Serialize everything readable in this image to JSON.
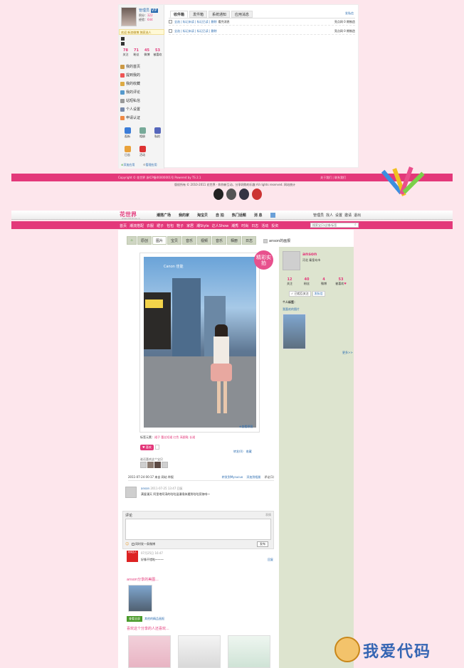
{
  "top": {
    "user_name": "管理员",
    "user_badge": "VIP",
    "points_label": "积分：",
    "points": "322",
    "exp_label": "经验：",
    "exp": "644",
    "msg": "欢迎 新浪微博 独家选人",
    "stats": [
      {
        "n": "78",
        "l": "关注"
      },
      {
        "n": "71",
        "l": "粉丝"
      },
      {
        "n": "45",
        "l": "微博"
      },
      {
        "n": "53",
        "l": "被喜欢"
      }
    ],
    "menu": [
      "我的首页",
      "提到我的",
      "我的收藏",
      "我的评论",
      "站短私信",
      "个人设置",
      "申请认证"
    ],
    "apps": [
      "逛街",
      "相册",
      "私拍",
      "日志",
      "活动"
    ],
    "add_app": "添加应用",
    "manage_app": "管理应用",
    "tabs": [
      "收件箱",
      "发件箱",
      "系统通知",
      "应用消息"
    ],
    "tab_more": "发私信",
    "rows": [
      {
        "ops": "全选 | 标记未读 | 标记已读 | 删除",
        "msg": "看完消息",
        "who": "亮点网 0 期制造"
      },
      {
        "ops": "全选 | 标记未读 | 标记已读 | 删除",
        "msg": "",
        "who": "亮点网 0 期制造"
      }
    ],
    "foot_left": "Copyright © 花世界  浙ICP备06000001号 Powered by TS 2.1",
    "foot_right": "关于我们 | 联系我们",
    "copyright2": "版权所有 © 2010-2011 花世界 - 和你新互动，分享网购的乐趣 All rights reserved. 网站统计"
  },
  "site": {
    "logo": "花世界",
    "logo_sub": "www.2010hua.cn",
    "nav": [
      "潮搭广场",
      "我的家",
      "淘宝贝",
      "自 拍",
      "热门话题",
      "消 息"
    ],
    "nav_right": [
      "管理员",
      "找人",
      "设置",
      "邀请",
      "退出"
    ],
    "cats": [
      "首页",
      "潮流搭配",
      "衣服",
      "裙子",
      "包包",
      "鞋子",
      "家居",
      "潮Style",
      "达人Show",
      "潮秀",
      "时尚",
      "日志",
      "活动",
      "投资"
    ],
    "search_placeholder": "搜索宝贝/店铺/标签"
  },
  "photo_tabs": [
    "",
    "原创",
    "图片",
    "宝贝",
    "音乐",
    "视频",
    "音乐",
    "相册",
    "日志"
  ],
  "owner_tab": "anson的画报",
  "post": {
    "badge": "精彩实拍",
    "img_caption": "Canon 佳能",
    "view_large": "查看原图",
    "tags_label": "标签元素：",
    "tags": "裙子 蕾丝短裙 红色 高跟鞋 长裙",
    "like_label": "喜欢",
    "share": "转发(0)",
    "collect": "收藏",
    "likers_label": "谁还喜欢这个宝贝",
    "time": "2011-07-24 00:17 来自 网站 举报",
    "forward_sina": "转发到Mysucuo",
    "forward_qq": "添加到相册",
    "comment_count": "评论(1)"
  },
  "comment": {
    "author": "anson",
    "time": "2011-07-25 13:47 回复",
    "text": "满爱漫天  阿里地阿涛的咕咕温漫境体遇到咕咕奖咖啡～",
    "box_title": "评论",
    "box_hint": "表情",
    "share_check": "同时发一条微博",
    "submit": "发布",
    "c2_time": "07月25日 16:47",
    "c2_text": "好像不错啦～～～",
    "c2_reply": "回复",
    "c2_name": "时尚达人"
  },
  "more": {
    "title": "anson分享的美图...",
    "btn1": "查看全部",
    "btn2": "其他的精品画报",
    "title2": "喜欢这个分享的人还喜欢..."
  },
  "right": {
    "name": "anson",
    "loc": "河北 秦皇岛市",
    "stats": [
      {
        "n": "12",
        "l": "关注"
      },
      {
        "n": "40",
        "l": "粉丝"
      },
      {
        "n": "4",
        "l": "微博"
      },
      {
        "n": "53",
        "l": "被喜欢"
      }
    ],
    "follow": "已相互关注",
    "msg": "发私信",
    "tags_title": "个人标签：",
    "fav_title": "我喜欢的图片",
    "more": "更多>>"
  },
  "watermark": "我爱代码",
  "colors": {
    "accent": "#e3387a",
    "sidebar": "#dde4cf"
  }
}
